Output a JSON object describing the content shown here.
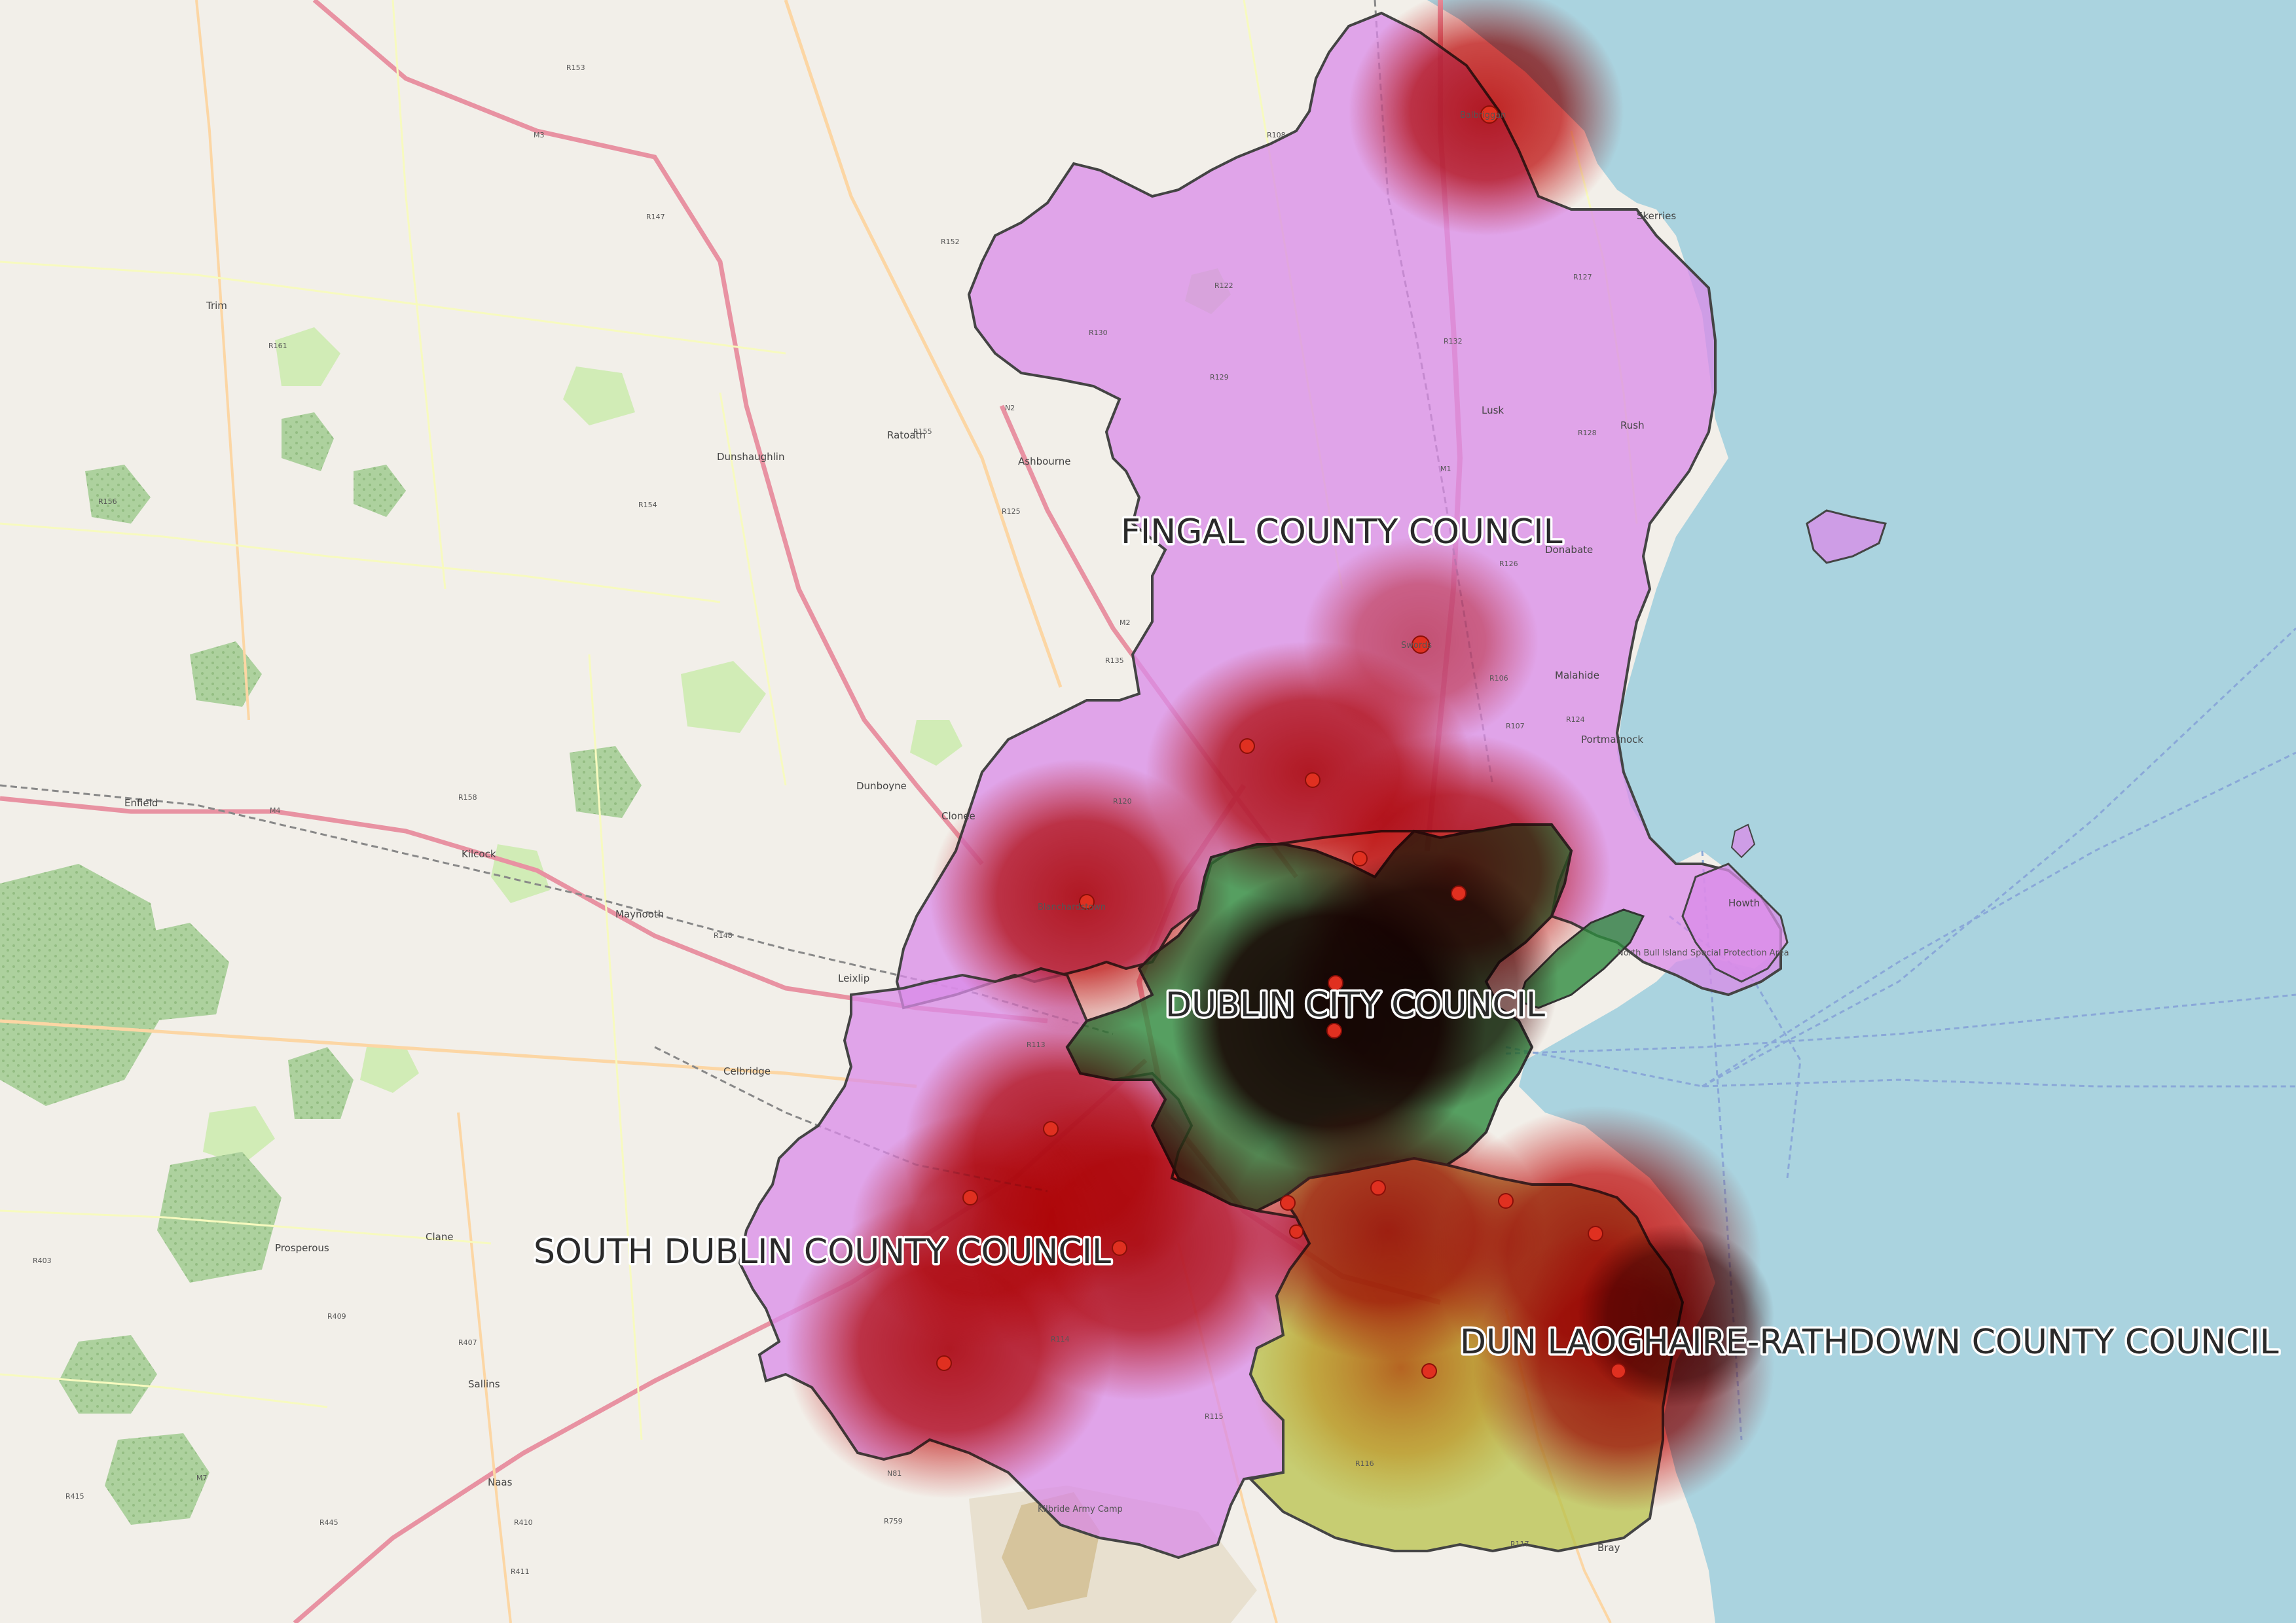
{
  "councils": [
    {
      "name": "FINGAL COUNTY COUNCIL",
      "color": "#d98be8"
    },
    {
      "name": "DUBLIN CITY COUNCIL",
      "color": "#2e8b3e"
    },
    {
      "name": "SOUTH DUBLIN COUNTY COUNCIL",
      "color": "#d98be8"
    },
    {
      "name": "DUN LAOGHAIRE-RATHDOWN COUNTY COUNCIL",
      "color": "#b8c24a"
    }
  ],
  "basemap": {
    "land_color": "#f2efe9",
    "sea_color": "#aad3df",
    "motorway_color": "#e892a2",
    "primary_road_color": "#fcd6a4",
    "park_color": "#c8facc",
    "forest_color": "#add19e"
  },
  "heatmap": {
    "hot_color": "#c00000",
    "core_color": "#400000",
    "warm_color": "#f0a020"
  },
  "place_labels": {
    "trim": "Trim",
    "dunshaughlin": "Dunshaughlin",
    "ratoath": "Ratoath",
    "ashbourne": "Ashbourne",
    "maynooth": "Maynooth",
    "leixlip": "Leixlip",
    "celbridge": "Celbridge",
    "clane": "Clane",
    "prosperous": "Prosperous",
    "naas": "Naas",
    "sallins": "Sallins",
    "enfield": "Enfield",
    "kilcock": "Kilcock",
    "dunboyne": "Dunboyne",
    "clonee": "Clonee",
    "lusk": "Lusk",
    "rush": "Rush",
    "skerries": "Skerries",
    "donabate": "Donabate",
    "malahide": "Malahide",
    "portmarnock": "Portmarnock",
    "howth": "Howth",
    "bray": "Bray",
    "kilbride_army_camp": "Kilbride Army Camp",
    "north_bull_island": "North Bull Island Special Protection Area",
    "blanchardstown": "Blanchardstown",
    "swords": "Swords",
    "balbriggan": "Balbriggan"
  },
  "road_labels": [
    "M1",
    "M2",
    "M3",
    "M4",
    "M7",
    "N2",
    "N7",
    "N81",
    "R125",
    "R132",
    "R122",
    "R106",
    "R148",
    "R403",
    "R407",
    "R409",
    "R410",
    "R445",
    "R411",
    "R415",
    "R147",
    "R154",
    "R156",
    "R158",
    "R161",
    "R153",
    "R152",
    "R155",
    "R135",
    "R108",
    "R127",
    "R128",
    "R126",
    "R124",
    "R107",
    "R129",
    "R130",
    "R120",
    "R113",
    "R114",
    "R115",
    "R116",
    "R117",
    "R759"
  ],
  "sites": [
    {
      "name": "balbriggan-site"
    },
    {
      "name": "swords-site"
    },
    {
      "name": "airport-site-1"
    },
    {
      "name": "airport-site-2"
    },
    {
      "name": "finglas-site"
    },
    {
      "name": "coolock-site"
    },
    {
      "name": "blanchardstown-site"
    },
    {
      "name": "city-centre-site-1"
    },
    {
      "name": "city-centre-site-2"
    },
    {
      "name": "clondalkin-site"
    },
    {
      "name": "lucan-site"
    },
    {
      "name": "tallaght-site"
    },
    {
      "name": "crumlin-site"
    },
    {
      "name": "rathfarnham-site"
    },
    {
      "name": "dundrum-site"
    },
    {
      "name": "blackrock-site"
    },
    {
      "name": "dun-laoghaire-site"
    },
    {
      "name": "sandyford-site"
    },
    {
      "name": "killiney-site"
    },
    {
      "name": "citywest-site"
    }
  ]
}
